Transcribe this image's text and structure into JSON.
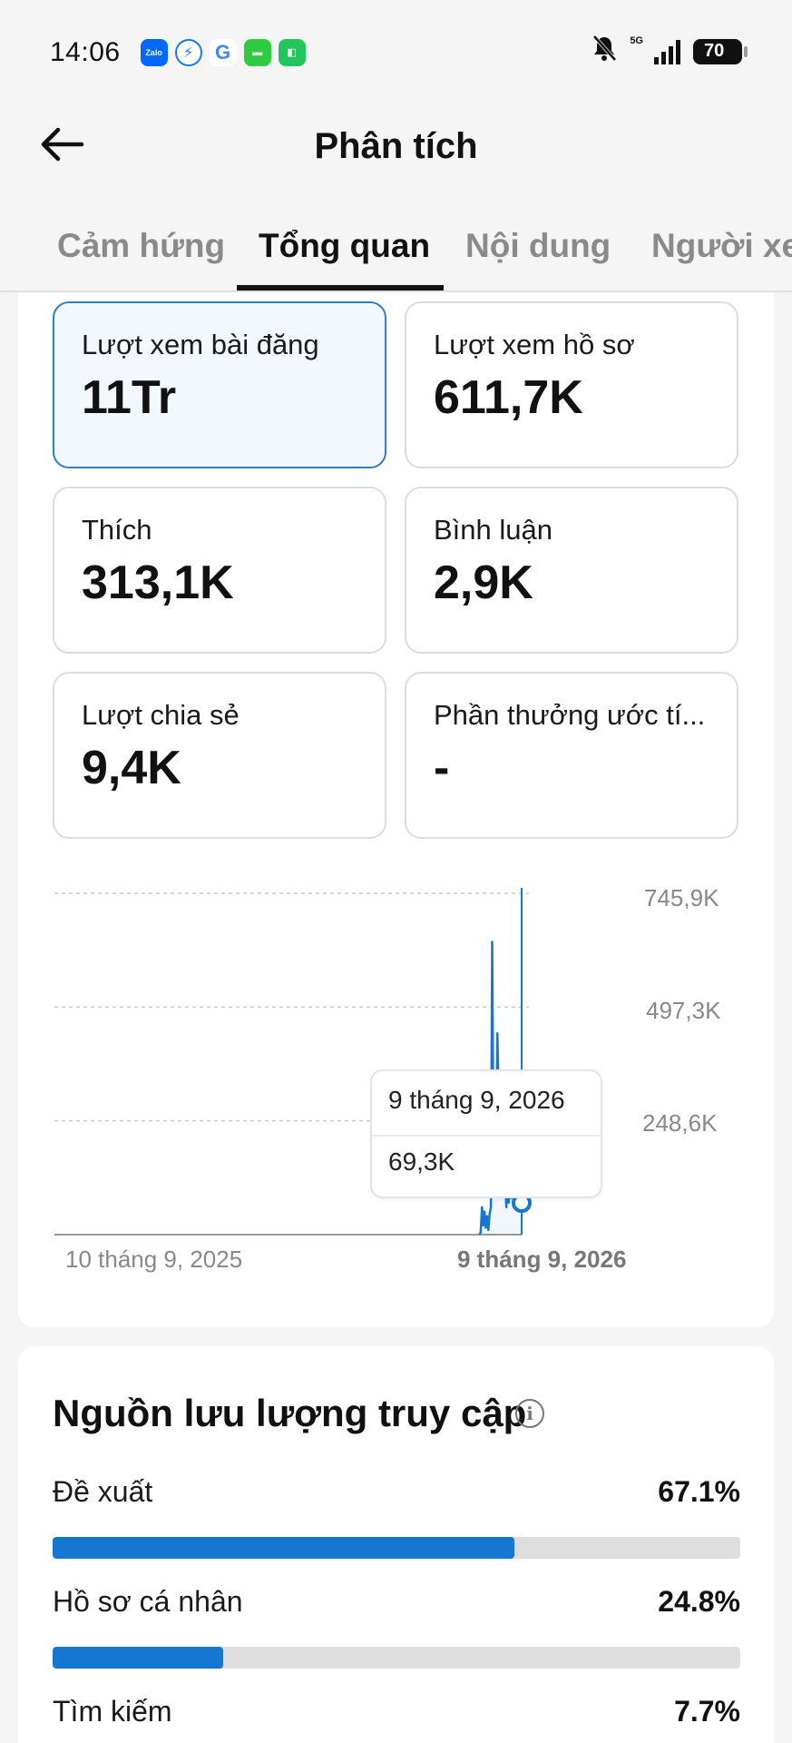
{
  "status_bar": {
    "time": "14:06",
    "network": "5G",
    "battery": "70",
    "notification_icons": [
      "zalo-icon",
      "messenger-icon",
      "google-icon",
      "messages-icon",
      "store-icon"
    ],
    "zalo_text": "Zalo"
  },
  "header": {
    "title": "Phân tích",
    "back_icon": "arrow-left-icon"
  },
  "tabs": [
    {
      "label": "Cảm hứng",
      "active": false
    },
    {
      "label": "Tổng quan",
      "active": true
    },
    {
      "label": "Nội dung",
      "active": false
    },
    {
      "label": "Người xe",
      "active": false
    }
  ],
  "metrics": [
    {
      "label": "Lượt xem bài đăng",
      "value": "11Tr",
      "selected": true
    },
    {
      "label": "Lượt xem hồ sơ",
      "value": "611,7K",
      "selected": false
    },
    {
      "label": "Thích",
      "value": "313,1K",
      "selected": false
    },
    {
      "label": "Bình luận",
      "value": "2,9K",
      "selected": false
    },
    {
      "label": "Lượt chia sẻ",
      "value": "9,4K",
      "selected": false
    },
    {
      "label": "Phần thưởng ước tí...",
      "value": "-",
      "selected": false
    }
  ],
  "chart_data": {
    "type": "line",
    "y_ticks": [
      "745,9K",
      "497,3K",
      "248,6K"
    ],
    "ylim": [
      0,
      745900
    ],
    "x_ticks": [
      "10 tháng 9, 2025",
      "9 tháng 9, 2026"
    ],
    "series_color": "#1677d2",
    "tooltip": {
      "date": "9 tháng 9, 2026",
      "value": "69,3K"
    },
    "series": [
      {
        "values_note_days_before_end": [
          -33,
          -32,
          -31,
          -30,
          -29,
          -28,
          -27,
          -26,
          -25,
          -24,
          -23,
          -22,
          -21,
          -20,
          -19,
          -18,
          -17,
          -16,
          -15,
          -14,
          -13,
          -12,
          -11,
          -10,
          -9,
          -8,
          -7,
          -6,
          -5,
          -4,
          -3,
          -2,
          -1,
          0
        ],
        "values": [
          0,
          4000,
          60000,
          20000,
          50000,
          15000,
          40000,
          10000,
          45000,
          60000,
          640000,
          180000,
          120000,
          95000,
          440000,
          310000,
          200000,
          170000,
          150000,
          90000,
          130000,
          60000,
          100000,
          70000,
          130000,
          80000,
          120000,
          60000,
          100000,
          110000,
          260000,
          75000,
          140000,
          69300
        ]
      }
    ]
  },
  "traffic": {
    "title": "Nguồn lưu lượng truy cập",
    "info_icon": "info-icon",
    "sources": [
      {
        "name": "Đề xuất",
        "percent_label": "67.1%",
        "percent": 67.1
      },
      {
        "name": "Hồ sơ cá nhân",
        "percent_label": "24.8%",
        "percent": 24.8
      },
      {
        "name": "Tìm kiếm",
        "percent_label": "7.7%",
        "percent": 7.7
      }
    ]
  }
}
